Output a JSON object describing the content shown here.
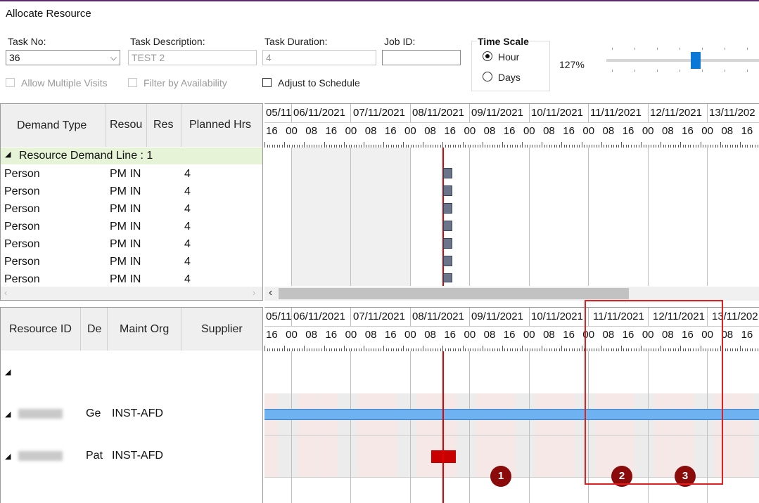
{
  "window": {
    "title": "Allocate Resource"
  },
  "form": {
    "task_no": {
      "label": "Task No:",
      "value": "36"
    },
    "task_description": {
      "label": "Task Description:",
      "value": "TEST 2"
    },
    "task_duration": {
      "label": "Task Duration:",
      "value": "4"
    },
    "job_id": {
      "label": "Job ID:",
      "value": ""
    },
    "allow_multiple_visits": "Allow Multiple Visits",
    "filter_by_availability": "Filter by Availability",
    "adjust_to_schedule": "Adjust to Schedule"
  },
  "time_scale": {
    "title": "Time Scale",
    "options": [
      "Hour",
      "Days"
    ],
    "selected": "Hour",
    "zoom": "127%",
    "zoom_level": 0.73
  },
  "demand_grid": {
    "columns": [
      "Demand Type",
      "Resou",
      "Res",
      "Planned Hrs"
    ],
    "group_label": "Resource Demand Line : 1",
    "rows": [
      [
        "Person",
        "PM IN",
        "4"
      ],
      [
        "Person",
        "PM IN",
        "4"
      ],
      [
        "Person",
        "PM IN",
        "4"
      ],
      [
        "Person",
        "PM IN",
        "4"
      ],
      [
        "Person",
        "PM IN",
        "4"
      ],
      [
        "Person",
        "PM IN",
        "4"
      ],
      [
        "Person",
        "PM IN",
        "4"
      ]
    ]
  },
  "resource_grid": {
    "columns": [
      "Resource ID",
      "De",
      "Maint Org",
      "Supplier"
    ],
    "rows": [
      {
        "de": "Ge",
        "maint_org": "INST-AFD"
      },
      {
        "de": "Pat",
        "maint_org": "INST-AFD"
      }
    ]
  },
  "timeline": {
    "dates": [
      "05/11",
      "06/11/2021",
      "07/11/2021",
      "08/11/2021",
      "09/11/2021",
      "10/11/2021",
      "11/11/2021",
      "12/11/2021",
      "13/11/202"
    ],
    "hours": [
      "16",
      "00",
      "08",
      "16",
      "00",
      "08",
      "16",
      "00",
      "08",
      "16",
      "00",
      "08",
      "16",
      "00",
      "08",
      "16",
      "00",
      "08",
      "16",
      "00",
      "08",
      "16",
      "00",
      "08",
      "16"
    ]
  },
  "markers": [
    "1",
    "2",
    "3"
  ],
  "colors": {
    "accent": "#0a78d7",
    "group_row": "#e6f3d6",
    "current_time": "#e00000",
    "task_bar": "#6b7488",
    "resource_bar": "#6fb2f2",
    "booking": "#c80000",
    "marker": "#8b0a0a",
    "highlight": "#e02020"
  }
}
